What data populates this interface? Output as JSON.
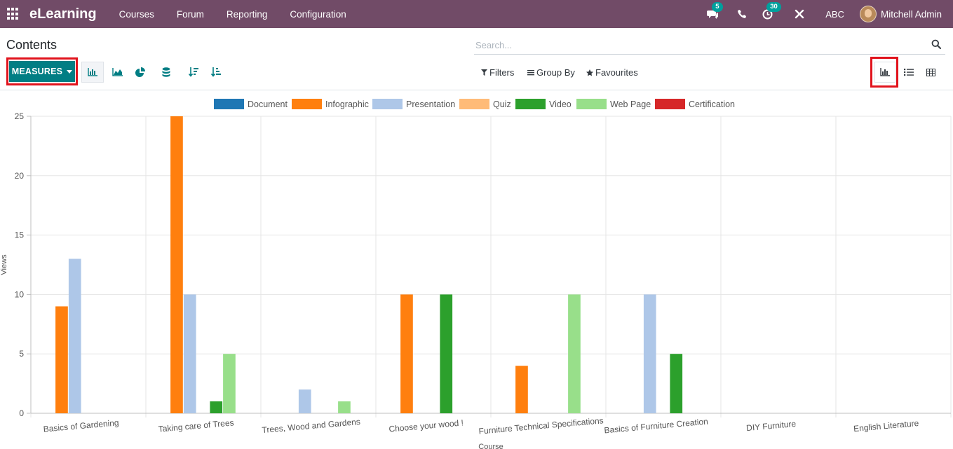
{
  "app": {
    "brand": "eLearning",
    "menu": [
      "Courses",
      "Forum",
      "Reporting",
      "Configuration"
    ],
    "messages_count": "5",
    "activities_count": "30",
    "company": "ABC",
    "user": "Mitchell Admin"
  },
  "control": {
    "title": "Contents",
    "search_placeholder": "Search...",
    "measures_label": "MEASURES",
    "filters_label": "Filters",
    "groupby_label": "Group By",
    "favourites_label": "Favourites"
  },
  "colors": {
    "navbar": "#714b67",
    "accent": "#017e84",
    "highlight": "#e1131c"
  },
  "chart_data": {
    "type": "bar",
    "xlabel": "Course",
    "ylabel": "Views",
    "ylim": [
      0,
      25
    ],
    "yticks": [
      "0",
      "5",
      "10",
      "15",
      "20",
      "25"
    ],
    "grid": true,
    "legend_position": "top",
    "categories": [
      "Basics of Gardening",
      "Taking care of Trees",
      "Trees, Wood and Gardens",
      "Choose your wood !",
      "Furniture Technical Specifications",
      "Basics of Furniture Creation",
      "DIY Furniture",
      "English Literature"
    ],
    "series": [
      {
        "name": "Document",
        "color": "#1f77b4",
        "values": [
          0,
          0,
          0,
          0,
          0,
          0,
          0,
          0
        ]
      },
      {
        "name": "Infographic",
        "color": "#ff7f0e",
        "values": [
          9,
          25,
          0,
          10,
          4,
          0,
          0,
          0
        ]
      },
      {
        "name": "Presentation",
        "color": "#aec7e8",
        "values": [
          13,
          10,
          2,
          0,
          0,
          10,
          0,
          0
        ]
      },
      {
        "name": "Quiz",
        "color": "#ffbb78",
        "values": [
          0,
          0,
          0,
          0,
          0,
          0,
          0,
          0
        ]
      },
      {
        "name": "Video",
        "color": "#2ca02c",
        "values": [
          0,
          1,
          0,
          10,
          0,
          5,
          0,
          0
        ]
      },
      {
        "name": "Web Page",
        "color": "#98df8a",
        "values": [
          0,
          5,
          1,
          0,
          10,
          0,
          0,
          0
        ]
      },
      {
        "name": "Certification",
        "color": "#d62728",
        "values": [
          0,
          0,
          0,
          0,
          0,
          0,
          0,
          0
        ]
      }
    ]
  }
}
